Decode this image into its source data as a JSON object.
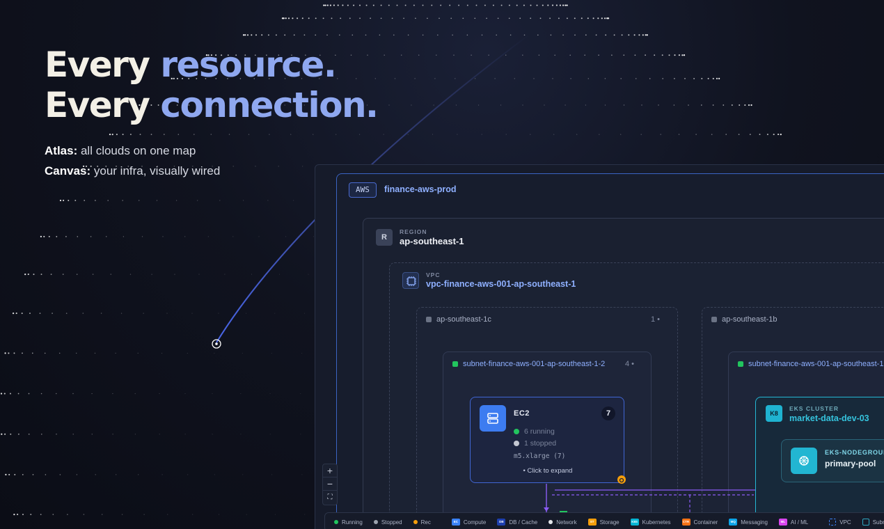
{
  "hero": {
    "line1_plain": "Every",
    "line1_accent": "resource.",
    "line2_plain": "Every",
    "line2_accent": "connection.",
    "atlas_label": "Atlas:",
    "atlas_text": "all clouds on one map",
    "canvas_label": "Canvas:",
    "canvas_text": "your infra, visually wired"
  },
  "canvas": {
    "account": {
      "tag": "AWS",
      "name": "finance-aws-prod"
    },
    "region": {
      "icon": "R",
      "caption": "REGION",
      "name": "ap-southeast-1"
    },
    "vpc": {
      "caption": "VPC",
      "name": "vpc-finance-aws-001-ap-southeast-1"
    },
    "zones": [
      {
        "name": "ap-southeast-1c",
        "count": "1 •"
      },
      {
        "name": "ap-southeast-1b",
        "count": ""
      }
    ],
    "subnets": [
      {
        "name": "subnet-finance-aws-001-ap-southeast-1-2",
        "count": "4 •"
      },
      {
        "name": "subnet-finance-aws-001-ap-southeast-1",
        "count": ""
      }
    ],
    "ec2": {
      "title": "EC2",
      "badge": "7",
      "running": "6 running",
      "stopped": "1 stopped",
      "instance_type": "m5.xlarge (7)",
      "expand": "• Click to expand"
    },
    "eks": {
      "icon": "K8",
      "caption": "EKS CLUSTER",
      "name": "market-data-dev-03",
      "nodegroup_caption": "EKS-NODEGROUP",
      "nodegroup_name": "primary-pool"
    },
    "zoom": {
      "in": "+",
      "out": "−",
      "fit": "⛶"
    },
    "legend": [
      {
        "kind": "dot",
        "color": "#22c55e",
        "label": "Running"
      },
      {
        "kind": "dot",
        "color": "#9ca3af",
        "label": "Stopped"
      },
      {
        "kind": "dot",
        "color": "#f59e0b",
        "label": "Rec"
      },
      {
        "kind": "chip",
        "color": "#3b82f6",
        "chip": "EC",
        "label": "Compute"
      },
      {
        "kind": "chip",
        "color": "#1e40af",
        "chip": "DB",
        "label": "DB / Cache"
      },
      {
        "kind": "dot",
        "color": "#e5e7eb",
        "label": "Network"
      },
      {
        "kind": "chip",
        "color": "#f59e0b",
        "chip": "ST",
        "label": "Storage"
      },
      {
        "kind": "chip",
        "color": "#06b6d4",
        "chip": "K8S",
        "label": "Kubernetes"
      },
      {
        "kind": "chip",
        "color": "#f97316",
        "chip": "CTR",
        "label": "Container"
      },
      {
        "kind": "chip",
        "color": "#0ea5e9",
        "chip": "MQ",
        "label": "Messaging"
      },
      {
        "kind": "chip",
        "color": "#d946ef",
        "chip": "ML",
        "label": "AI / ML"
      },
      {
        "kind": "vpc",
        "color": "#3b82f6",
        "label": "VPC"
      },
      {
        "kind": "sub",
        "color": "#2ea8c2",
        "label": "Subnet"
      }
    ]
  },
  "colors": {
    "accent": "#8fa8f0",
    "aws_border": "#3b64c4",
    "eks": "#25b8d6",
    "running": "#22c55e",
    "stopped": "#9ca3af",
    "connector": "#8b5cf6"
  },
  "icons": {
    "vpc": "vpc-chip-icon",
    "ec2": "server-stack-icon",
    "nodegroup": "kubernetes-helm-icon",
    "warning": "warning-icon"
  }
}
